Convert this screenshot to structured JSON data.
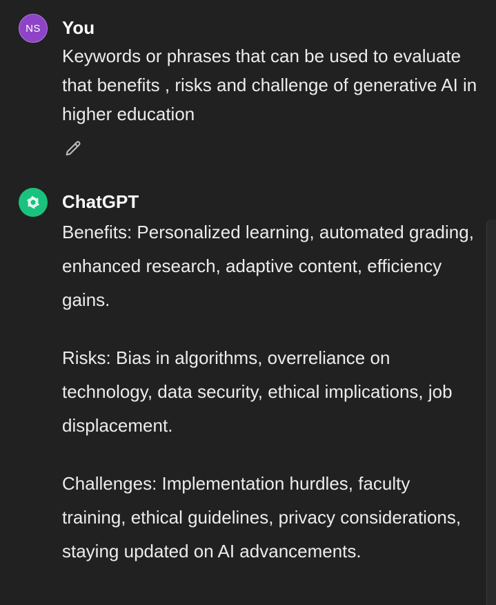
{
  "user_message": {
    "avatar_initials": "NS",
    "author": "You",
    "text": "Keywords or phrases that can be used to evaluate that benefits  , risks and challenge of generative AI in higher education"
  },
  "assistant_message": {
    "author": "ChatGPT",
    "paragraphs": [
      "Benefits: Personalized learning, automated grading, enhanced research, adaptive content, efficiency gains.",
      "Risks: Bias in algorithms, overreliance on technology, data security, ethical implications, job displacement.",
      "Challenges: Implementation hurdles, faculty training, ethical guidelines, privacy considerations, staying updated on AI advancements."
    ]
  },
  "icons": {
    "edit": "pencil-icon",
    "assistant_avatar": "openai-logo-icon"
  },
  "colors": {
    "background": "#212121",
    "text": "#ececec",
    "user_avatar": "#8e44c7",
    "assistant_avatar": "#19c37d"
  }
}
